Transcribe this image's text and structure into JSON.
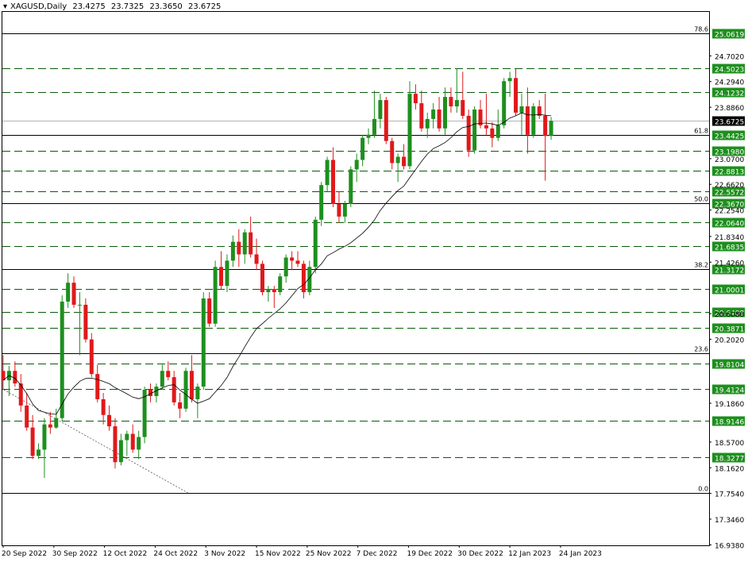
{
  "header": {
    "symbol_timeframe": "XAGUSD,Daily",
    "open": "23.4275",
    "high": "23.7325",
    "low": "23.3650",
    "close": "23.6725",
    "collapse_glyph": "triangle-down-icon"
  },
  "colors": {
    "bull": "#1e8f1e",
    "bear": "#e0191b",
    "grid_dashed": "#0a5a0a",
    "label_bg": "#1e8f1e",
    "current_label_bg": "#000000"
  },
  "chart_data": {
    "type": "candlestick",
    "symbol": "XAGUSD",
    "timeframe": "Daily",
    "y_axis_range": [
      16.93,
      25.4
    ],
    "price_axis_ticks": [
      "24.7020",
      "24.2940",
      "23.8860",
      "23.0700",
      "22.6620",
      "22.2540",
      "21.8340",
      "21.4260",
      "20.6080",
      "20.2020",
      "19.1860",
      "18.5700",
      "18.1620",
      "17.7540",
      "17.3460",
      "16.9380"
    ],
    "date_axis_labels": [
      "20 Sep 2022",
      "30 Sep 2022",
      "12 Oct 2022",
      "24 Oct 2022",
      "3 Nov 2022",
      "15 Nov 2022",
      "25 Nov 2022",
      "7 Dec 2022",
      "19 Dec 2022",
      "30 Dec 2022",
      "12 Jan 2023",
      "24 Jan 2023"
    ],
    "dashed_levels": [
      "25.0619",
      "24.5023",
      "24.1232",
      "23.4425",
      "23.1980",
      "22.8813",
      "22.5572",
      "22.3670",
      "22.0640",
      "21.6835",
      "21.3172",
      "21.0001",
      "20.6408",
      "20.3871",
      "19.8104",
      "19.4124",
      "18.9146",
      "18.3277"
    ],
    "fibonacci_levels": [
      {
        "label": "78.6",
        "value": 25.0619
      },
      {
        "label": "61.8",
        "value": 23.4425
      },
      {
        "label": "50.0",
        "value": 22.367
      },
      {
        "label": "38.2",
        "value": 21.3172
      },
      {
        "label": "23.6",
        "value": 19.98
      },
      {
        "label": "0.0",
        "value": 17.76
      }
    ],
    "current_price": "23.6725",
    "moving_average": "20-period simple moving average (thin black line)",
    "candles": [
      {
        "o": 19.7,
        "h": 19.95,
        "l": 19.4,
        "c": 19.55
      },
      {
        "o": 19.55,
        "h": 19.78,
        "l": 19.3,
        "c": 19.7
      },
      {
        "o": 19.7,
        "h": 19.85,
        "l": 19.45,
        "c": 19.5
      },
      {
        "o": 19.5,
        "h": 19.65,
        "l": 19.05,
        "c": 19.15
      },
      {
        "o": 19.15,
        "h": 19.35,
        "l": 18.75,
        "c": 18.8
      },
      {
        "o": 18.8,
        "h": 19.0,
        "l": 18.3,
        "c": 18.35
      },
      {
        "o": 18.35,
        "h": 18.55,
        "l": 18.3,
        "c": 18.45
      },
      {
        "o": 18.45,
        "h": 18.95,
        "l": 18.0,
        "c": 18.85
      },
      {
        "o": 18.85,
        "h": 19.05,
        "l": 18.7,
        "c": 18.8
      },
      {
        "o": 18.8,
        "h": 19.1,
        "l": 18.78,
        "c": 18.95
      },
      {
        "o": 18.95,
        "h": 20.9,
        "l": 18.9,
        "c": 20.8
      },
      {
        "o": 20.8,
        "h": 21.25,
        "l": 20.7,
        "c": 21.1
      },
      {
        "o": 21.1,
        "h": 21.2,
        "l": 20.7,
        "c": 20.75
      },
      {
        "o": 20.75,
        "h": 20.95,
        "l": 19.95,
        "c": 20.75
      },
      {
        "o": 20.75,
        "h": 20.85,
        "l": 20.15,
        "c": 20.2
      },
      {
        "o": 20.2,
        "h": 20.3,
        "l": 19.6,
        "c": 19.65
      },
      {
        "o": 19.65,
        "h": 19.8,
        "l": 19.2,
        "c": 19.25
      },
      {
        "o": 19.25,
        "h": 19.35,
        "l": 18.85,
        "c": 19.0
      },
      {
        "o": 19.0,
        "h": 19.15,
        "l": 18.75,
        "c": 18.82
      },
      {
        "o": 18.82,
        "h": 18.95,
        "l": 18.15,
        "c": 18.25
      },
      {
        "o": 18.25,
        "h": 18.7,
        "l": 18.2,
        "c": 18.6
      },
      {
        "o": 18.6,
        "h": 18.75,
        "l": 18.35,
        "c": 18.7
      },
      {
        "o": 18.7,
        "h": 18.85,
        "l": 18.4,
        "c": 18.45
      },
      {
        "o": 18.45,
        "h": 18.75,
        "l": 18.3,
        "c": 18.65
      },
      {
        "o": 18.65,
        "h": 19.45,
        "l": 18.55,
        "c": 19.4
      },
      {
        "o": 19.4,
        "h": 19.5,
        "l": 19.2,
        "c": 19.3
      },
      {
        "o": 19.3,
        "h": 19.5,
        "l": 19.2,
        "c": 19.45
      },
      {
        "o": 19.45,
        "h": 19.8,
        "l": 19.4,
        "c": 19.7
      },
      {
        "o": 19.7,
        "h": 19.85,
        "l": 19.55,
        "c": 19.6
      },
      {
        "o": 19.6,
        "h": 19.7,
        "l": 19.15,
        "c": 19.2
      },
      {
        "o": 19.2,
        "h": 19.35,
        "l": 18.95,
        "c": 19.1
      },
      {
        "o": 19.1,
        "h": 19.75,
        "l": 19.05,
        "c": 19.7
      },
      {
        "o": 19.7,
        "h": 19.95,
        "l": 19.2,
        "c": 19.25
      },
      {
        "o": 19.25,
        "h": 19.5,
        "l": 18.95,
        "c": 19.45
      },
      {
        "o": 19.45,
        "h": 20.95,
        "l": 19.4,
        "c": 20.85
      },
      {
        "o": 20.85,
        "h": 20.95,
        "l": 20.4,
        "c": 20.45
      },
      {
        "o": 20.45,
        "h": 21.45,
        "l": 20.4,
        "c": 21.35
      },
      {
        "o": 21.35,
        "h": 21.6,
        "l": 21.0,
        "c": 21.05
      },
      {
        "o": 21.05,
        "h": 21.55,
        "l": 20.95,
        "c": 21.45
      },
      {
        "o": 21.45,
        "h": 21.85,
        "l": 21.35,
        "c": 21.75
      },
      {
        "o": 21.75,
        "h": 21.95,
        "l": 21.35,
        "c": 21.55
      },
      {
        "o": 21.55,
        "h": 21.95,
        "l": 21.4,
        "c": 21.9
      },
      {
        "o": 21.9,
        "h": 22.15,
        "l": 21.5,
        "c": 21.55
      },
      {
        "o": 21.55,
        "h": 21.8,
        "l": 21.3,
        "c": 21.4
      },
      {
        "o": 21.4,
        "h": 21.45,
        "l": 20.9,
        "c": 20.95
      },
      {
        "o": 20.95,
        "h": 21.05,
        "l": 20.8,
        "c": 21.0
      },
      {
        "o": 21.0,
        "h": 21.05,
        "l": 20.7,
        "c": 20.95
      },
      {
        "o": 20.95,
        "h": 21.25,
        "l": 20.9,
        "c": 21.2
      },
      {
        "o": 21.2,
        "h": 21.55,
        "l": 21.1,
        "c": 21.5
      },
      {
        "o": 21.5,
        "h": 21.6,
        "l": 21.3,
        "c": 21.45
      },
      {
        "o": 21.45,
        "h": 21.6,
        "l": 21.35,
        "c": 21.4
      },
      {
        "o": 21.4,
        "h": 21.45,
        "l": 20.85,
        "c": 20.95
      },
      {
        "o": 20.95,
        "h": 21.45,
        "l": 20.9,
        "c": 21.35
      },
      {
        "o": 21.35,
        "h": 22.15,
        "l": 21.25,
        "c": 22.1
      },
      {
        "o": 22.1,
        "h": 22.7,
        "l": 22.0,
        "c": 22.65
      },
      {
        "o": 22.65,
        "h": 23.1,
        "l": 22.55,
        "c": 23.05
      },
      {
        "o": 23.05,
        "h": 23.25,
        "l": 22.3,
        "c": 22.35
      },
      {
        "o": 22.35,
        "h": 22.55,
        "l": 22.05,
        "c": 22.15
      },
      {
        "o": 22.15,
        "h": 22.4,
        "l": 22.05,
        "c": 22.35
      },
      {
        "o": 22.35,
        "h": 22.95,
        "l": 22.3,
        "c": 22.9
      },
      {
        "o": 22.9,
        "h": 23.15,
        "l": 22.7,
        "c": 23.05
      },
      {
        "o": 23.05,
        "h": 23.45,
        "l": 22.95,
        "c": 23.4
      },
      {
        "o": 23.4,
        "h": 23.55,
        "l": 23.3,
        "c": 23.45
      },
      {
        "o": 23.45,
        "h": 24.15,
        "l": 23.4,
        "c": 23.7
      },
      {
        "o": 23.7,
        "h": 24.1,
        "l": 23.55,
        "c": 24.0
      },
      {
        "o": 24.0,
        "h": 24.05,
        "l": 23.3,
        "c": 23.35
      },
      {
        "o": 23.35,
        "h": 23.4,
        "l": 22.9,
        "c": 23.0
      },
      {
        "o": 23.0,
        "h": 23.15,
        "l": 22.7,
        "c": 23.1
      },
      {
        "o": 23.1,
        "h": 23.3,
        "l": 22.9,
        "c": 22.95
      },
      {
        "o": 22.95,
        "h": 24.3,
        "l": 22.9,
        "c": 24.1
      },
      {
        "o": 24.1,
        "h": 24.25,
        "l": 23.85,
        "c": 23.95
      },
      {
        "o": 23.95,
        "h": 24.15,
        "l": 23.5,
        "c": 23.55
      },
      {
        "o": 23.55,
        "h": 23.8,
        "l": 23.4,
        "c": 23.7
      },
      {
        "o": 23.7,
        "h": 23.95,
        "l": 23.55,
        "c": 23.85
      },
      {
        "o": 23.85,
        "h": 24.05,
        "l": 23.5,
        "c": 23.55
      },
      {
        "o": 23.55,
        "h": 24.2,
        "l": 23.45,
        "c": 24.05
      },
      {
        "o": 24.05,
        "h": 24.2,
        "l": 23.8,
        "c": 23.9
      },
      {
        "o": 23.9,
        "h": 24.5,
        "l": 23.8,
        "c": 24.0
      },
      {
        "o": 24.0,
        "h": 24.45,
        "l": 23.7,
        "c": 23.75
      },
      {
        "o": 23.75,
        "h": 23.85,
        "l": 23.1,
        "c": 23.2
      },
      {
        "o": 23.2,
        "h": 23.9,
        "l": 23.15,
        "c": 23.85
      },
      {
        "o": 23.85,
        "h": 24.0,
        "l": 23.55,
        "c": 23.6
      },
      {
        "o": 23.6,
        "h": 24.1,
        "l": 23.45,
        "c": 23.55
      },
      {
        "o": 23.55,
        "h": 23.65,
        "l": 23.25,
        "c": 23.4
      },
      {
        "o": 23.4,
        "h": 23.85,
        "l": 23.35,
        "c": 23.6
      },
      {
        "o": 23.6,
        "h": 24.35,
        "l": 23.55,
        "c": 24.3
      },
      {
        "o": 24.3,
        "h": 24.45,
        "l": 24.05,
        "c": 24.35
      },
      {
        "o": 24.35,
        "h": 24.5,
        "l": 23.75,
        "c": 23.8
      },
      {
        "o": 23.8,
        "h": 24.1,
        "l": 23.45,
        "c": 23.9
      },
      {
        "o": 23.9,
        "h": 24.2,
        "l": 23.15,
        "c": 23.45
      },
      {
        "o": 23.45,
        "h": 23.95,
        "l": 23.4,
        "c": 23.9
      },
      {
        "o": 23.9,
        "h": 24.0,
        "l": 23.7,
        "c": 23.75
      },
      {
        "o": 23.75,
        "h": 24.1,
        "l": 22.72,
        "c": 23.43
      },
      {
        "o": 23.43,
        "h": 23.73,
        "l": 23.37,
        "c": 23.67
      }
    ]
  }
}
